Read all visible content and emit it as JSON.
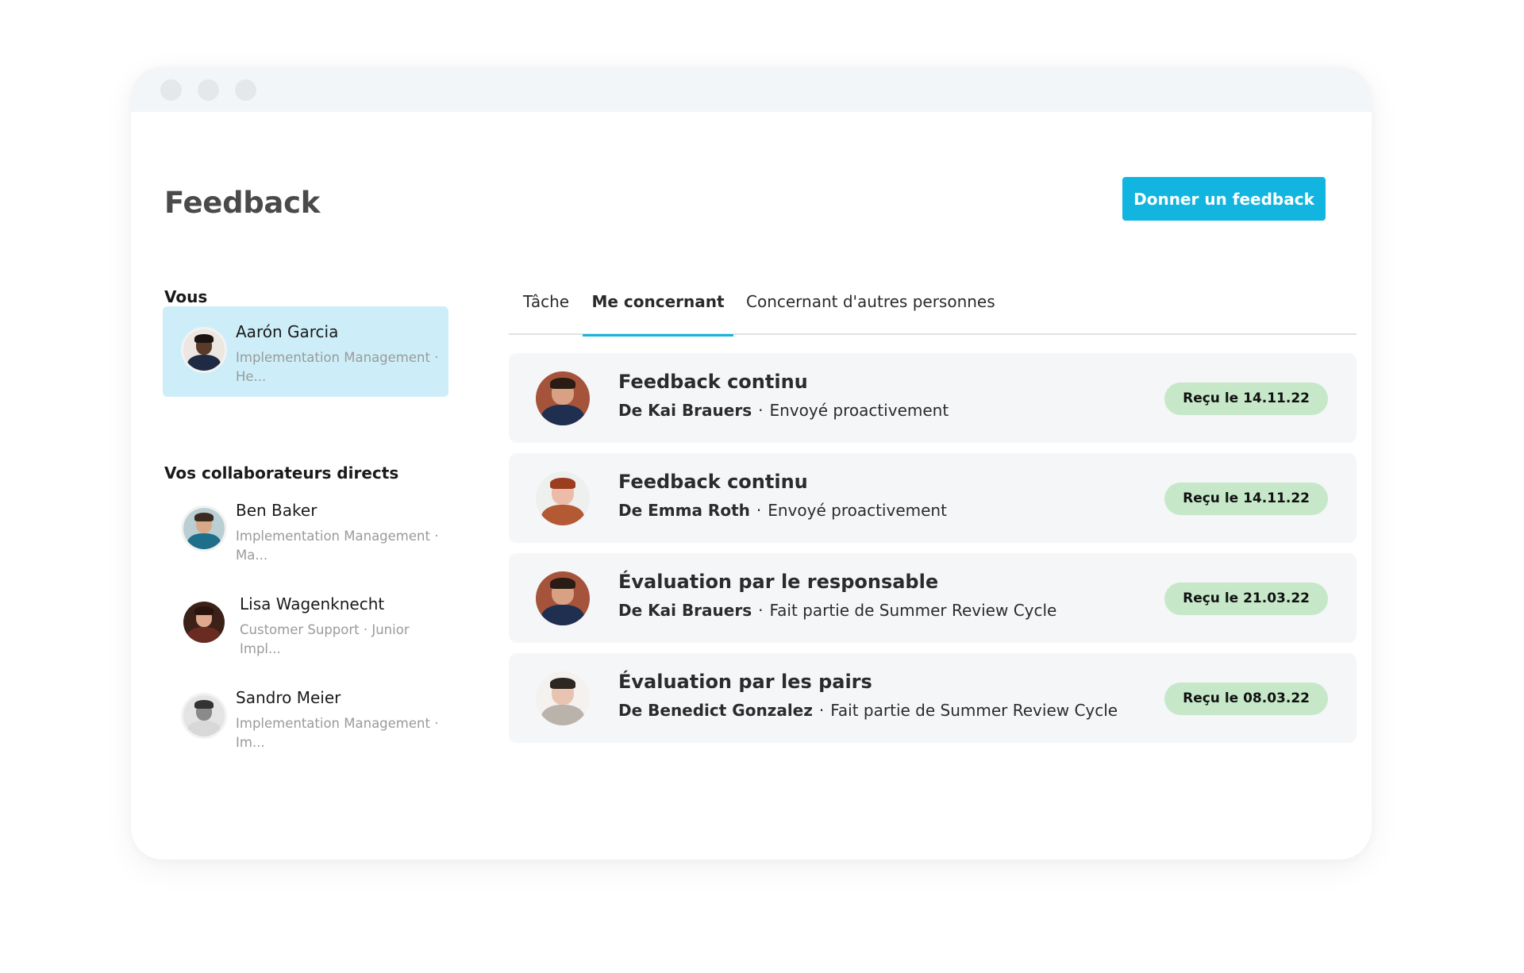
{
  "window": {
    "title": "Feedback",
    "primary_button": "Donner un feedback"
  },
  "sidebar": {
    "you_label": "Vous",
    "you": {
      "name": "Aarón Garcia",
      "role": "Implementation Management · He..."
    },
    "reports_label": "Vos collaborateurs directs",
    "reports": [
      {
        "name": "Ben Baker",
        "role": "Implementation Management · Ma..."
      },
      {
        "name": "Lisa Wagenknecht",
        "role": "Customer Support · Junior Impl..."
      },
      {
        "name": "Sandro Meier",
        "role": "Implementation Management · Im..."
      }
    ]
  },
  "tabs": [
    {
      "label": "Tâche",
      "active": false
    },
    {
      "label": "Me concernant",
      "active": true
    },
    {
      "label": "Concernant d'autres personnes",
      "active": false
    }
  ],
  "feedback_items": [
    {
      "title": "Feedback continu",
      "from": "De Kai Brauers",
      "separator": "·",
      "context": "Envoyé proactivement",
      "badge": "Reçu le 14.11.22"
    },
    {
      "title": "Feedback continu",
      "from": "De Emma Roth",
      "separator": "·",
      "context": "Envoyé proactivement",
      "badge": "Reçu le 14.11.22"
    },
    {
      "title": "Évaluation par le responsable",
      "from": "De Kai Brauers",
      "separator": "·",
      "context": "Fait partie de Summer Review Cycle",
      "badge": "Reçu le 21.03.22"
    },
    {
      "title": "Évaluation par les pairs",
      "from": "De Benedict Gonzalez",
      "separator": "·",
      "context": "Fait partie de Summer Review Cycle",
      "badge": "Reçu le 08.03.22"
    }
  ],
  "colors": {
    "accent": "#12b5e0",
    "selected_bg": "#cdeef8",
    "badge_bg": "#c6e8c9",
    "card_bg": "#f4f6f8"
  }
}
